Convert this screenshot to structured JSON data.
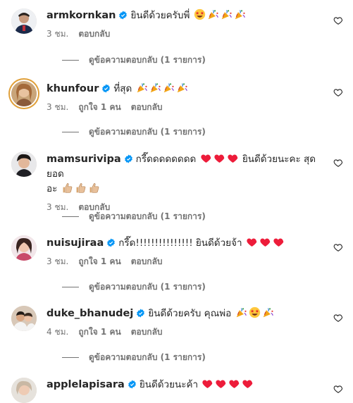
{
  "colors": {
    "text": "#262626",
    "meta": "#737373",
    "verified": "#0095f6",
    "heart_red": "#ed1c3a"
  },
  "comments": [
    {
      "username": "armkornkan",
      "text": "ยินดีด้วยครับพี่",
      "emojis": [
        "star-eyes",
        "party-popper",
        "party-popper",
        "party-popper"
      ],
      "time": "3 ชม.",
      "likes": "",
      "reply": "ตอบกลับ",
      "view_replies": "ดูข้อความตอบกลับ (1 รายการ)"
    },
    {
      "username": "khunfour",
      "text": "ที่สุด",
      "emojis": [
        "party-popper",
        "party-popper",
        "party-popper",
        "party-popper"
      ],
      "time": "3 ชม.",
      "likes": "ถูกใจ 1 คน",
      "reply": "ตอบกลับ",
      "view_replies": "ดูข้อความตอบกลับ (1 รายการ)"
    },
    {
      "username": "mamsurivipa",
      "text": "กรี๊ดดดดดดดด",
      "text2": "ยินดีด้วยนะคะ สุดยอด",
      "text3": "อะ",
      "emojis": [
        "red-heart",
        "red-heart",
        "red-heart"
      ],
      "emojis2": [
        "thumbs-up",
        "thumbs-up",
        "thumbs-up"
      ],
      "time": "3 ชม.",
      "likes": "",
      "reply": "ตอบกลับ",
      "view_replies": "ดูข้อความตอบกลับ (1 รายการ)"
    },
    {
      "username": "nuisujiraa",
      "text": "กรี๊ด!!!!!!!!!!!!!!! ยินดีด้วยจ้า",
      "emojis": [
        "red-heart",
        "red-heart",
        "red-heart"
      ],
      "time": "3 ชม.",
      "likes": "ถูกใจ 1 คน",
      "reply": "ตอบกลับ",
      "view_replies": "ดูข้อความตอบกลับ (1 รายการ)"
    },
    {
      "username": "duke_bhanudej",
      "text": "ยินดีด้วยครับ คุณพ่อ",
      "emojis": [
        "party-popper",
        "star-eyes",
        "party-popper"
      ],
      "time": "4 ชม.",
      "likes": "ถูกใจ 1 คน",
      "reply": "ตอบกลับ",
      "view_replies": "ดูข้อความตอบกลับ (1 รายการ)"
    },
    {
      "username": "applelapisara",
      "text": "ยินดีด้วยนะค้า",
      "emojis": [
        "red-heart",
        "red-heart",
        "red-heart",
        "red-heart"
      ]
    }
  ]
}
